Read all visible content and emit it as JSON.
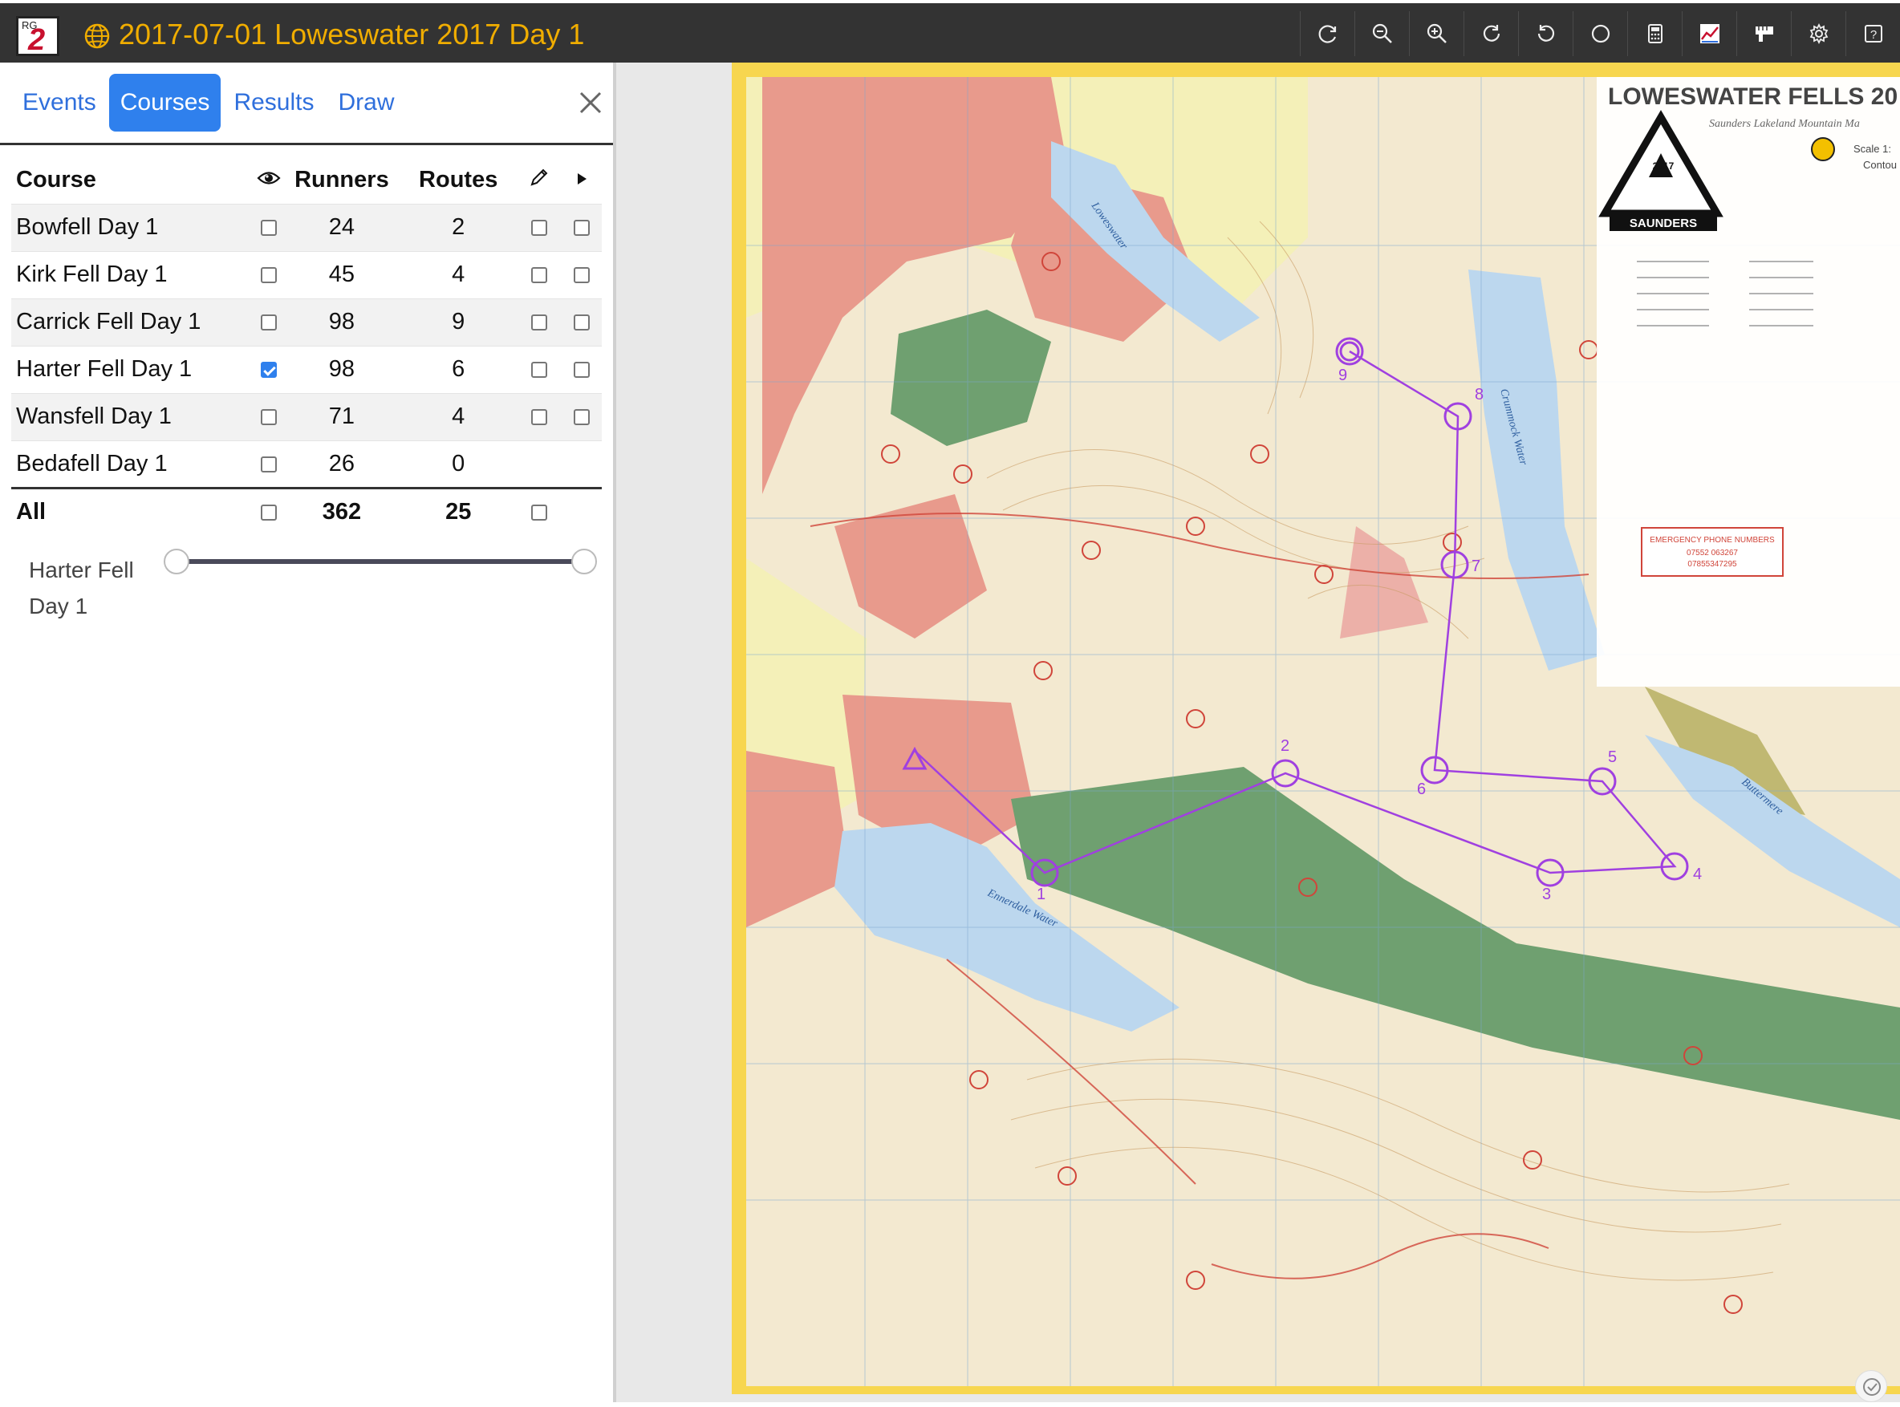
{
  "app": {
    "logo_text": "RG2",
    "event_title": "2017-07-01 Loweswater 2017 Day 1"
  },
  "toolbar": {
    "buttons": [
      "reset-view-icon",
      "zoom-out-icon",
      "zoom-in-icon",
      "rotate-right-icon",
      "rotate-left-icon",
      "circle-icon",
      "print-icon",
      "gps-track-icon",
      "measure-icon",
      "settings-icon",
      "help-icon"
    ]
  },
  "tabs": [
    {
      "label": "Events"
    },
    {
      "label": "Courses"
    },
    {
      "label": "Results"
    },
    {
      "label": "Draw"
    }
  ],
  "active_tab": "Courses",
  "courses_table": {
    "headers": {
      "course": "Course",
      "runners": "Runners",
      "routes": "Routes"
    },
    "header_icons": [
      "eye-icon",
      "pencil-icon",
      "play-icon"
    ],
    "rows": [
      {
        "name": "Bowfell Day 1",
        "shown": false,
        "runners": "24",
        "routes": "2",
        "has_draw": true
      },
      {
        "name": "Kirk Fell Day 1",
        "shown": false,
        "runners": "45",
        "routes": "4",
        "has_draw": true
      },
      {
        "name": "Carrick Fell Day 1",
        "shown": false,
        "runners": "98",
        "routes": "9",
        "has_draw": true
      },
      {
        "name": "Harter Fell Day 1",
        "shown": true,
        "runners": "98",
        "routes": "6",
        "has_draw": true
      },
      {
        "name": "Wansfell Day 1",
        "shown": false,
        "runners": "71",
        "routes": "4",
        "has_draw": true
      },
      {
        "name": "Bedafell Day 1",
        "shown": false,
        "runners": "26",
        "routes": "0",
        "has_draw": false
      }
    ],
    "total": {
      "name": "All",
      "runners": "362",
      "routes": "25"
    }
  },
  "slider": {
    "label": "Harter Fell Day 1",
    "value_start": 0,
    "value_end": 1
  },
  "map": {
    "title": "LOWESWATER FELLS 20",
    "subtitle": "Saunders Lakeland Mountain Ma",
    "badge_text": "SAUNDERS",
    "badge_year": "2017",
    "scale_text": "Scale 1:",
    "contour_text": "Contou",
    "emergency_title": "EMERGENCY PHONE NUMBERS",
    "emergency_num_1": "07552 063267",
    "emergency_num_2": "07855347295",
    "lake_labels": [
      "Loweswater",
      "Crummock Water",
      "Ennerdale Water",
      "Buttermere"
    ],
    "control_labels": [
      "1",
      "2",
      "3",
      "4",
      "5",
      "6",
      "7",
      "8",
      "9"
    ],
    "colors": {
      "course": "#a040e0",
      "terrain": "#f3e9d0",
      "field": "#f4f0b8",
      "farmland": "#e89a8c",
      "forest": "#6fa070",
      "lake": "#bcd7ee",
      "frame": "#f7d64f"
    }
  }
}
